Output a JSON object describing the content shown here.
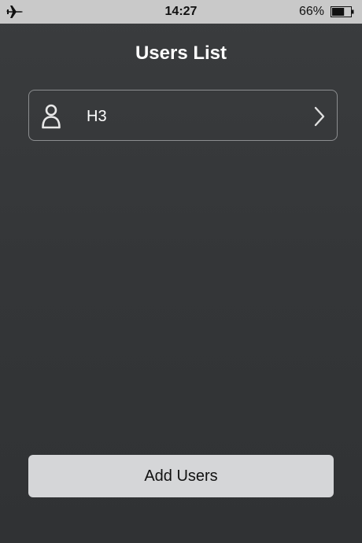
{
  "status_bar": {
    "time": "14:27",
    "battery_percent": "66%",
    "battery_level": 0.66,
    "mode_icon": "airplane-icon"
  },
  "header": {
    "title": "Users List"
  },
  "users": [
    {
      "name": "H3",
      "icon": "person-icon"
    }
  ],
  "actions": {
    "add_users_label": "Add Users"
  },
  "colors": {
    "background": "#353739",
    "status_bar": "#c9c9c9",
    "row_border": "#8c8e90",
    "button": "#d5d6d8"
  }
}
